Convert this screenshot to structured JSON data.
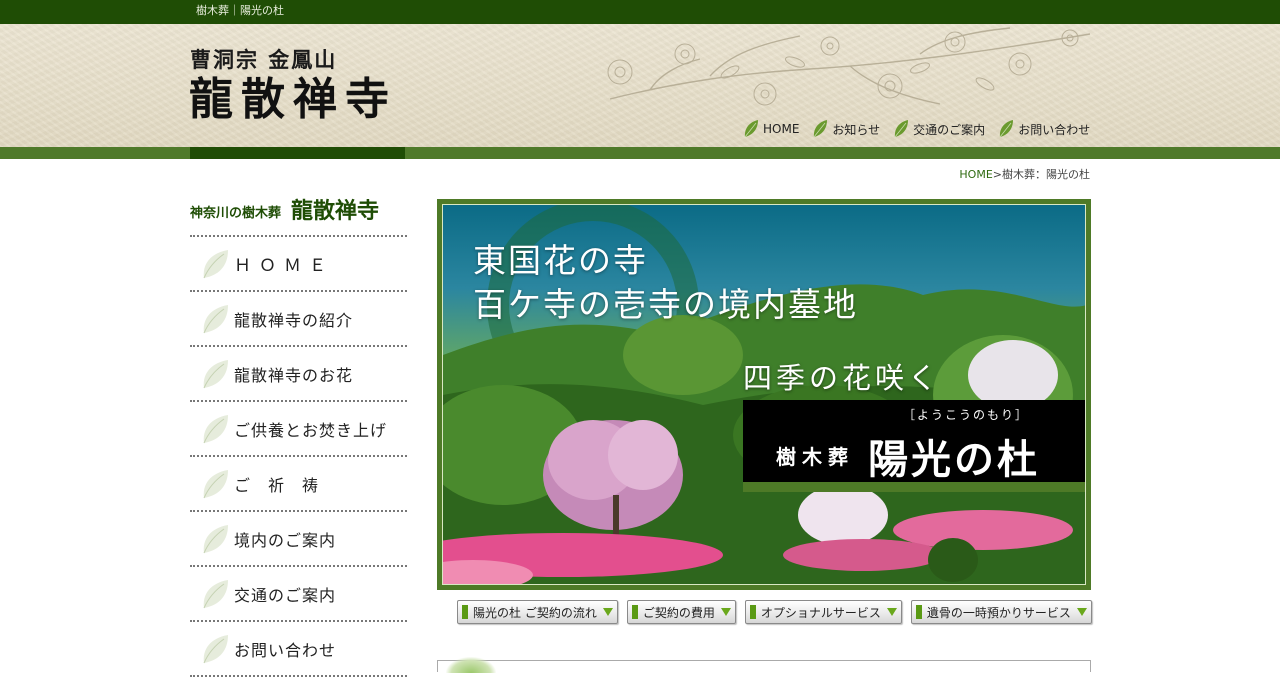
{
  "topbar": {
    "tagline": "樹木葬｜陽光の杜"
  },
  "header": {
    "sect": "曹洞宗 金鳳山",
    "temple": "龍散禅寺",
    "nav": [
      {
        "label": "HOME"
      },
      {
        "label": "お知らせ"
      },
      {
        "label": "交通のご案内"
      },
      {
        "label": "お問い合わせ"
      }
    ]
  },
  "breadcrumb": {
    "home": "HOME",
    "separator": ">",
    "current": "樹木葬：陽光の杜"
  },
  "sidebar": {
    "title_small": "神奈川の樹木葬",
    "title_big": "龍散禅寺",
    "items": [
      {
        "label": "ＨＯＭＥ"
      },
      {
        "label": "龍散禅寺の紹介"
      },
      {
        "label": "龍散禅寺のお花"
      },
      {
        "label": "ご供養とお焚き上げ"
      },
      {
        "label": "ご　祈　祷"
      },
      {
        "label": "境内のご案内"
      },
      {
        "label": "交通のご案内"
      },
      {
        "label": "お問い合わせ"
      }
    ]
  },
  "hero": {
    "line1": "東国花の寺",
    "line2": "百ケ寺の壱寺の境内墓地",
    "line3": "四季の花咲く",
    "ruby": "［ようこうのもり］",
    "small_title": "樹木葬",
    "big_title": "陽光の杜"
  },
  "subnav": [
    {
      "label": "陽光の杜 ご契約の流れ"
    },
    {
      "label": "ご契約の費用"
    },
    {
      "label": "オプショナルサービス"
    },
    {
      "label": "遺骨の一時預かりサービス"
    }
  ],
  "colors": {
    "topbar": "#1f4d05",
    "stripe": "#4f7a2a",
    "accent_green": "#5a9a14",
    "link_green": "#2f6b10"
  }
}
